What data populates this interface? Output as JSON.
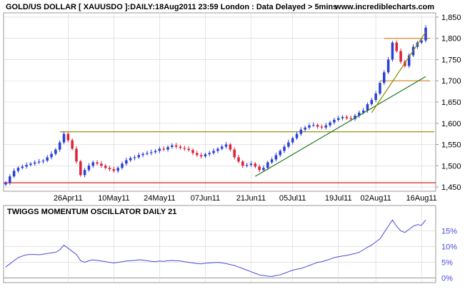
{
  "chart_data": [
    {
      "type": "candlestick",
      "title": "GOLD/US DOLLAR [ XAUUSDO ]:DAILY:18Aug2011 23:59 London : Data Delayed > 5mins",
      "watermark": "www.incrediblecharts.com",
      "x_tick_labels": [
        "26Apr11",
        "10May11",
        "24May11",
        "07Jun11",
        "21Jun11",
        "05Jul11",
        "19Jul11",
        "02Aug11",
        "16Aug11"
      ],
      "y_tick_labels": [
        "1,850",
        "1,800",
        "1,750",
        "1,700",
        "1,650",
        "1,600",
        "1,550",
        "1,500",
        "1,450"
      ],
      "ylim": [
        1440,
        1860
      ],
      "colors": {
        "up": "#2a3fd6",
        "down": "#e0203a",
        "grid": "#d4d4d4",
        "trend": "#1f7a1f",
        "support": "#8a8a00",
        "resistance": "#d98a2a",
        "floor": "#d42020"
      },
      "closes": [
        1460,
        1475,
        1488,
        1495,
        1498,
        1502,
        1505,
        1508,
        1510,
        1512,
        1520,
        1528,
        1538,
        1555,
        1575,
        1560,
        1540,
        1510,
        1478,
        1490,
        1500,
        1508,
        1505,
        1500,
        1495,
        1492,
        1488,
        1495,
        1505,
        1513,
        1518,
        1520,
        1525,
        1528,
        1530,
        1532,
        1535,
        1540,
        1538,
        1544,
        1548,
        1545,
        1542,
        1540,
        1537,
        1530,
        1525,
        1522,
        1527,
        1530,
        1535,
        1540,
        1545,
        1550,
        1538,
        1520,
        1510,
        1500,
        1502,
        1505,
        1498,
        1490,
        1495,
        1508,
        1515,
        1525,
        1535,
        1545,
        1555,
        1565,
        1575,
        1585,
        1590,
        1595,
        1596,
        1592,
        1590,
        1595,
        1602,
        1608,
        1612,
        1615,
        1612,
        1610,
        1618,
        1625,
        1630,
        1645,
        1655,
        1670,
        1695,
        1720,
        1750,
        1790,
        1770,
        1745,
        1735,
        1760,
        1780,
        1790,
        1795,
        1825
      ],
      "horizontal_levels": {
        "support": 1580,
        "resistance_upper": 1800,
        "resistance_lower": 1700,
        "floor": 1460
      },
      "trendlines": [
        {
          "name": "long-trendline",
          "from": [
            60,
            1475
          ],
          "to": [
            101,
            1710
          ]
        },
        {
          "name": "steep-trendline",
          "from": [
            88,
            1625
          ],
          "to": [
            101,
            1815
          ]
        }
      ]
    },
    {
      "type": "line",
      "title": "TWIGGS MOMENTUM OSCILLATOR DAILY 21",
      "y_tick_labels": [
        "15%",
        "10%",
        "5%",
        "0%"
      ],
      "ylim": [
        -1,
        19
      ],
      "color": "#4a4ad8",
      "values": [
        3.5,
        4.5,
        5.5,
        6.5,
        7.0,
        7.4,
        7.5,
        7.5,
        7.4,
        7.6,
        7.8,
        8.0,
        8.2,
        9.0,
        10.5,
        9.5,
        8.5,
        7.5,
        5.5,
        5.0,
        5.5,
        5.8,
        5.6,
        5.4,
        5.2,
        5.0,
        4.8,
        5.0,
        5.2,
        5.4,
        5.5,
        5.6,
        5.8,
        5.7,
        5.5,
        5.3,
        5.2,
        5.4,
        5.3,
        5.5,
        5.6,
        5.5,
        5.4,
        5.2,
        5.0,
        4.8,
        4.6,
        4.5,
        4.7,
        4.8,
        4.9,
        5.0,
        4.8,
        4.6,
        4.3,
        4.0,
        3.5,
        3.0,
        2.5,
        2.0,
        1.5,
        1.0,
        0.8,
        0.6,
        0.5,
        0.8,
        1.0,
        1.5,
        2.0,
        2.5,
        2.8,
        3.0,
        3.5,
        4.0,
        4.5,
        5.0,
        5.2,
        5.6,
        6.0,
        6.5,
        6.8,
        7.0,
        7.2,
        7.5,
        7.8,
        8.2,
        9.0,
        9.8,
        10.5,
        11.5,
        12.5,
        14.5,
        16.5,
        18.5,
        16.5,
        15.0,
        14.5,
        15.5,
        16.5,
        17.0,
        16.8,
        18.5
      ]
    }
  ]
}
